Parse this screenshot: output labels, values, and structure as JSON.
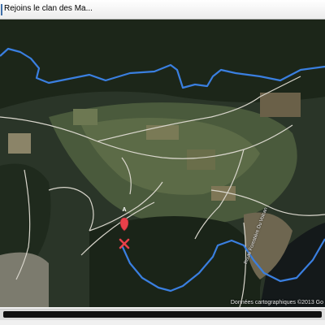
{
  "window": {
    "title": "Rejoins le clan des Ma...",
    "icon": "app-icon"
  },
  "map": {
    "view": "satellite",
    "attribution": "Données cartographiques ©2013 Go",
    "road_label": "Route Forestière Du Volcan",
    "marker": {
      "label": "A",
      "icon": "map-pin-icon",
      "color": "#e8404a"
    },
    "start_marker": {
      "icon": "x-mark-icon",
      "color": "#e8404a"
    },
    "route_color": "#3a7fe0",
    "road_color": "#d9d6cc"
  },
  "scrollbar": {
    "position": 0
  }
}
